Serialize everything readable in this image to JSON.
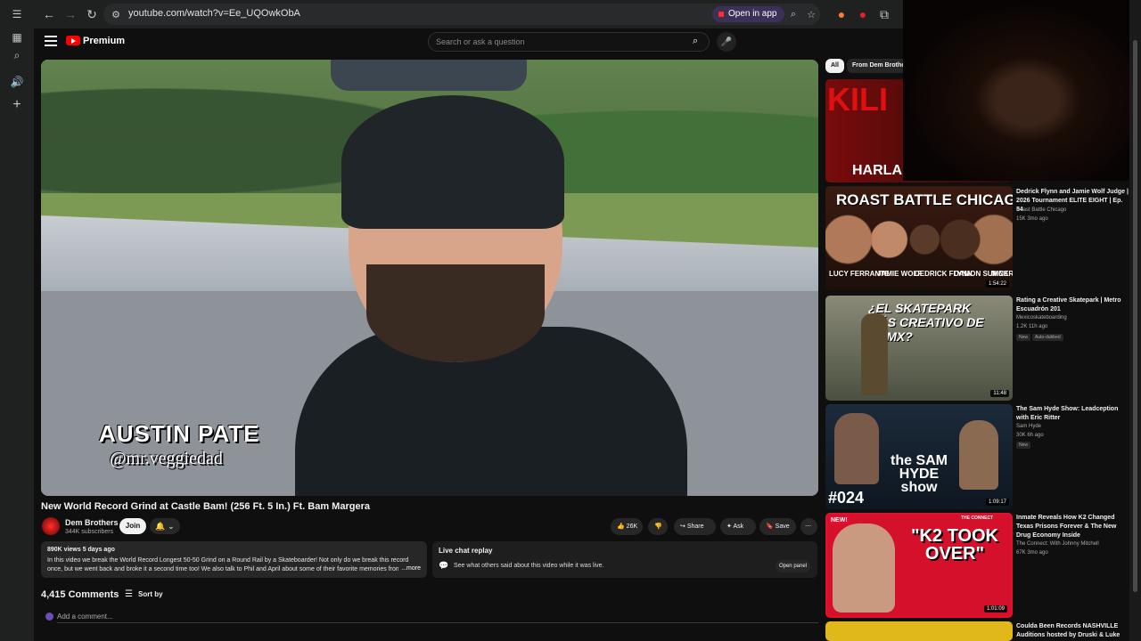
{
  "browser": {
    "url": "youtube.com/watch?v=Ee_UQOwkObA",
    "open_in_app": "Open in app"
  },
  "header": {
    "brand": "Premium",
    "search_placeholder": "Search or ask a question"
  },
  "video": {
    "title": "New World Record Grind at Castle Bam! (256 Ft. 5 In.) Ft. Bam Margera",
    "caption_name": "AUSTIN PATE",
    "caption_handle": "@mr.veggiedad",
    "channel": "Dem Brothers",
    "subscribers": "344K subscribers",
    "join_label": "Join",
    "likes": "26K",
    "share_label": "Share",
    "ask_label": "Ask",
    "save_label": "Save"
  },
  "description": {
    "meta": "890K views  5 days ago",
    "text": "In this video we break the World Record Longest 50-50 Grind on a Round Rail by a Skateboarder! Not only do we break this record once, but we went back and broke it a second time too! We also talk to Phil and April about some of their favorite memories from Cas",
    "more": "...more"
  },
  "live_chat": {
    "title": "Live chat replay",
    "text": "See what others said about this video while it was live.",
    "button": "Open panel"
  },
  "comments": {
    "count": "4,415 Comments",
    "sort_label": "Sort by",
    "placeholder": "Add a comment..."
  },
  "sidebar": {
    "chips": [
      "All",
      "From Dem Brothers"
    ],
    "items": [
      {
        "thumb_text": "HARLAN",
        "thumb_top_text": "KILI"
      },
      {
        "title": "Dedrick Flynn and Jamie Wolf Judge | 2026 Tournament ELITE EIGHT | Ep. 54",
        "channel": "Roast Battle Chicago",
        "stats": "15K  3mo ago",
        "thumb_text": "ROAST BATTLE CHICAGO",
        "thumb_names": [
          "LUCY FERRANTE",
          "JAMIE WOLF",
          "DEDRICK FLYNN",
          "DAMON SUMNER",
          "NICK"
        ],
        "duration": "1:54:22"
      },
      {
        "title": "Rating a Creative Skatepark | Metro Escuadrón 201",
        "channel": "Mexicoskateboarding",
        "stats": "1.2K  11h ago",
        "badges": [
          "New",
          "Auto-dubbed"
        ],
        "thumb_text": "¿EL SKATEPARK MÁS CREATIVO DE CDMX?",
        "duration": "11:48"
      },
      {
        "title": "The Sam Hyde Show: Leadception with Eric Ritter",
        "channel": "Sam Hyde",
        "stats": "30K  6h ago",
        "badges": [
          "New"
        ],
        "thumb_text": "#024",
        "thumb_logo": "the SAM HYDE show",
        "duration": "1:09:17"
      },
      {
        "title": "Inmate Reveals How K2 Changed Texas Prisons Forever & The New Drug Economy Inside",
        "channel": "The Connect: With Johnny Mitchell",
        "stats": "67K  3mo ago",
        "thumb_text": "\"K2 TOOK OVER\"",
        "thumb_tag": "NEW!",
        "thumb_corner": "THE CONNECT",
        "duration": "1:01:09"
      },
      {
        "title": "Coulda Been Records NASHVILLE Auditions hosted by Druski & Luke"
      }
    ]
  },
  "colors": {
    "bg": "#0f0f0f",
    "accent": "#ff0000",
    "chip_active": "#f1f1f1"
  }
}
